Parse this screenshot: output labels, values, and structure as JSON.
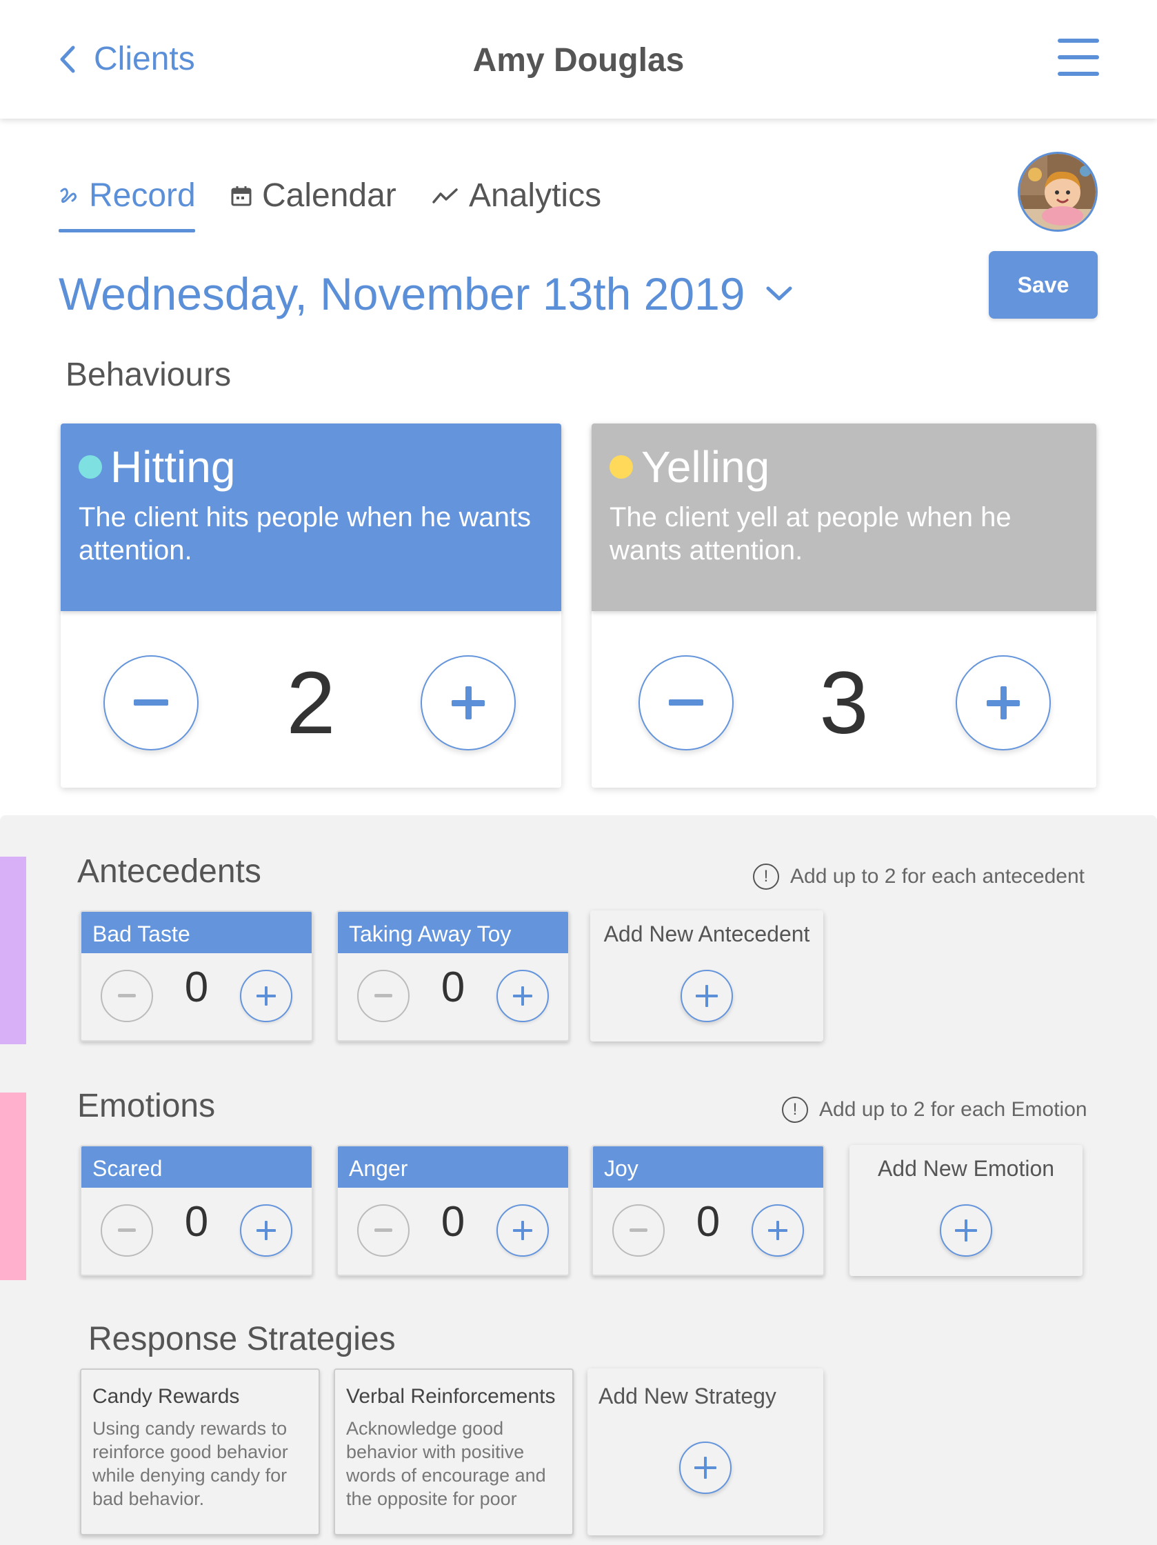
{
  "header": {
    "back_label": "Clients",
    "title": "Amy Douglas"
  },
  "tabs": [
    {
      "label": "Record",
      "icon": "record-squiggle-icon",
      "active": true
    },
    {
      "label": "Calendar",
      "icon": "calendar-icon",
      "active": false
    },
    {
      "label": "Analytics",
      "icon": "analytics-icon",
      "active": false
    }
  ],
  "date": "Wednesday, November 13th 2019",
  "save_label": "Save",
  "behaviours": {
    "heading": "Behaviours",
    "items": [
      {
        "name": "Hitting",
        "description": "The client hits people when he wants attention.",
        "count": "2",
        "color": "#6495dc",
        "dot": "#7ee0e0"
      },
      {
        "name": "Yelling",
        "description": "The client yell at people when he wants attention.",
        "count": "3",
        "color": "#bdbdbd",
        "dot": "#ffd95a"
      }
    ]
  },
  "antecedents": {
    "heading": "Antecedents",
    "hint": "Add up to 2 for each antecedent",
    "items": [
      {
        "label": "Bad Taste",
        "count": "0"
      },
      {
        "label": "Taking Away Toy",
        "count": "0"
      }
    ],
    "add_label": "Add New Antecedent",
    "accent": "#d8b0f8"
  },
  "emotions": {
    "heading": "Emotions",
    "hint": "Add up to 2 for each Emotion",
    "items": [
      {
        "label": "Scared",
        "count": "0"
      },
      {
        "label": "Anger",
        "count": "0"
      },
      {
        "label": "Joy",
        "count": "0"
      }
    ],
    "add_label": "Add New Emotion",
    "accent": "#ffb0cc"
  },
  "strategies": {
    "heading": "Response Strategies",
    "items": [
      {
        "title": "Candy Rewards",
        "description": "Using candy rewards to reinforce good behavior while denying candy for bad behavior."
      },
      {
        "title": "Verbal Reinforcements",
        "description": "Acknowledge good behavior with positive words of encourage and the opposite for poor"
      }
    ],
    "add_label": "Add New Strategy"
  },
  "colors": {
    "accent": "#5b8fd8",
    "button": "#6495dc",
    "panel": "#f2f2f2"
  }
}
